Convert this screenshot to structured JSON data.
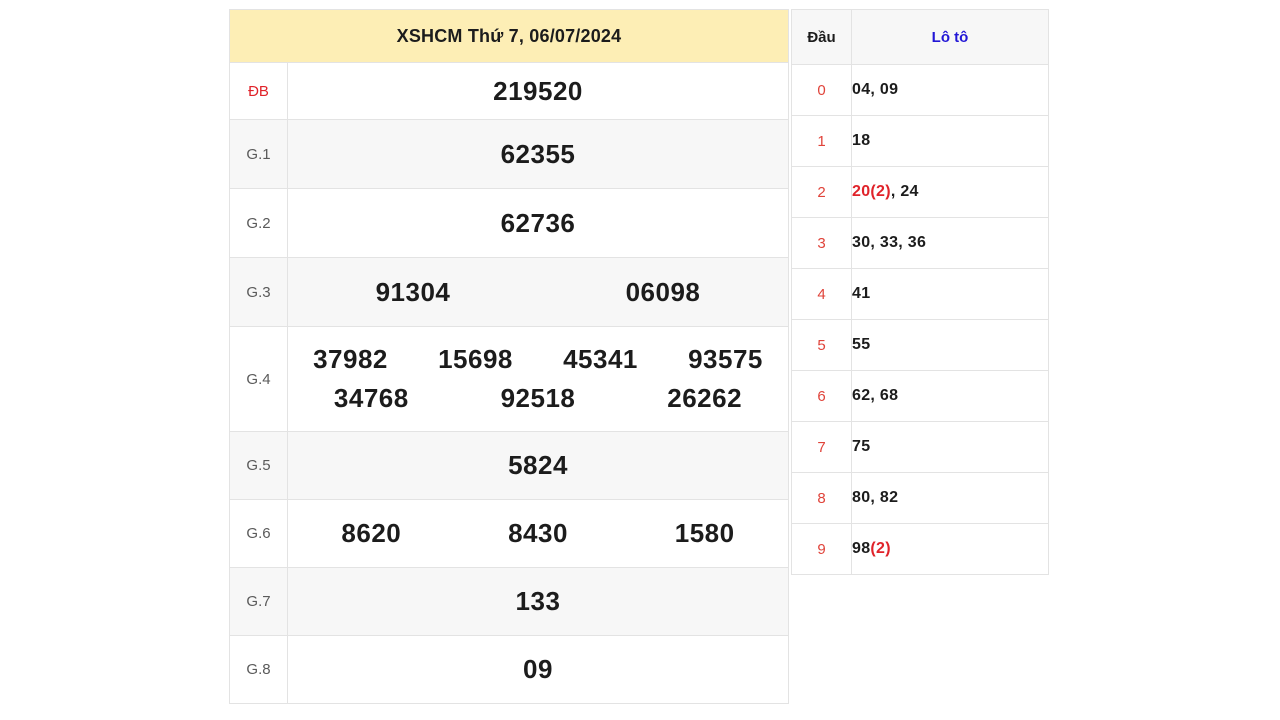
{
  "result_table": {
    "title": "XSHCM Thứ 7, 06/07/2024",
    "rows": [
      {
        "label": "ĐB",
        "values": [
          "219520"
        ]
      },
      {
        "label": "G.1",
        "values": [
          "62355"
        ]
      },
      {
        "label": "G.2",
        "values": [
          "62736"
        ]
      },
      {
        "label": "G.3",
        "values": [
          "91304",
          "06098"
        ]
      },
      {
        "label": "G.4",
        "values": [
          "37982",
          "15698",
          "45341",
          "93575",
          "34768",
          "92518",
          "26262"
        ]
      },
      {
        "label": "G.5",
        "values": [
          "5824"
        ]
      },
      {
        "label": "G.6",
        "values": [
          "8620",
          "8430",
          "1580"
        ]
      },
      {
        "label": "G.7",
        "values": [
          "133"
        ]
      },
      {
        "label": "G.8",
        "values": [
          "09"
        ]
      }
    ],
    "g4_row1": [
      "37982",
      "15698",
      "45341",
      "93575"
    ],
    "g4_row2": [
      "34768",
      "92518",
      "26262"
    ]
  },
  "loto_table": {
    "header_dau": "Đầu",
    "header_loto": "Lô tô",
    "accent_color": "#2216d6",
    "rows": [
      {
        "head": "0",
        "plain": "04, 09",
        "hot": "",
        "tail": ""
      },
      {
        "head": "1",
        "plain": "18",
        "hot": "",
        "tail": ""
      },
      {
        "head": "2",
        "plain": "",
        "hot": "20(2)",
        "tail": ", 24"
      },
      {
        "head": "3",
        "plain": "30, 33, 36",
        "hot": "",
        "tail": ""
      },
      {
        "head": "4",
        "plain": "41",
        "hot": "",
        "tail": ""
      },
      {
        "head": "5",
        "plain": "55",
        "hot": "",
        "tail": ""
      },
      {
        "head": "6",
        "plain": "62, 68",
        "hot": "",
        "tail": ""
      },
      {
        "head": "7",
        "plain": "75",
        "hot": "",
        "tail": ""
      },
      {
        "head": "8",
        "plain": "80, 82",
        "hot": "",
        "tail": ""
      },
      {
        "head": "9",
        "plain": "98",
        "hot": "(2)",
        "tail": ""
      }
    ]
  }
}
